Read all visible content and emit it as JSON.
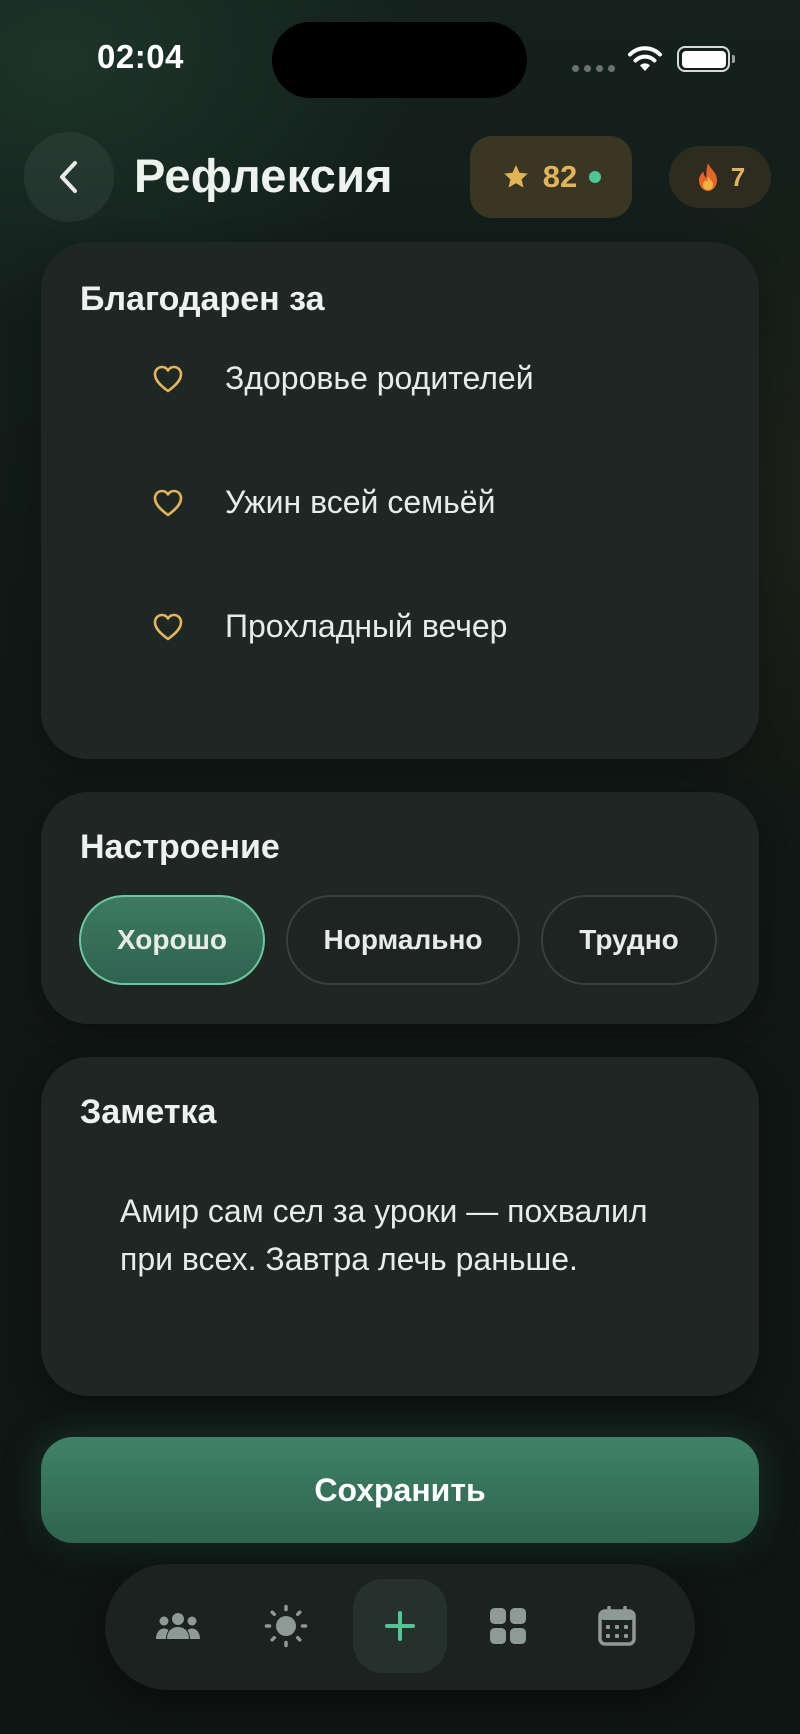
{
  "status_bar": {
    "time": "02:04"
  },
  "header": {
    "title": "Рефлексия",
    "points": "82",
    "streak": "7"
  },
  "gratitude": {
    "title": "Благодарен за",
    "items": [
      {
        "text": "Здоровье родителей"
      },
      {
        "text": "Ужин всей семьёй"
      },
      {
        "text": "Прохладный вечер"
      }
    ]
  },
  "mood": {
    "title": "Настроение",
    "options": [
      {
        "label": "Хорошо",
        "selected": true
      },
      {
        "label": "Нормально",
        "selected": false
      },
      {
        "label": "Трудно",
        "selected": false
      }
    ]
  },
  "note": {
    "title": "Заметка",
    "text": "Амир сам сел за уроки — похвалил при всех. Завтра лечь раньше."
  },
  "save_label": "Сохранить",
  "tabbar": {
    "tabs": [
      {
        "icon": "family-icon",
        "active": false
      },
      {
        "icon": "sun-icon",
        "active": false
      },
      {
        "icon": "plus-icon",
        "active": true
      },
      {
        "icon": "grid-icon",
        "active": false
      },
      {
        "icon": "calendar-icon",
        "active": false
      }
    ]
  },
  "colors": {
    "accent_green": "#3f8268",
    "gold": "#e2b458",
    "card_bg": "#1f2724",
    "background": "#101715"
  }
}
